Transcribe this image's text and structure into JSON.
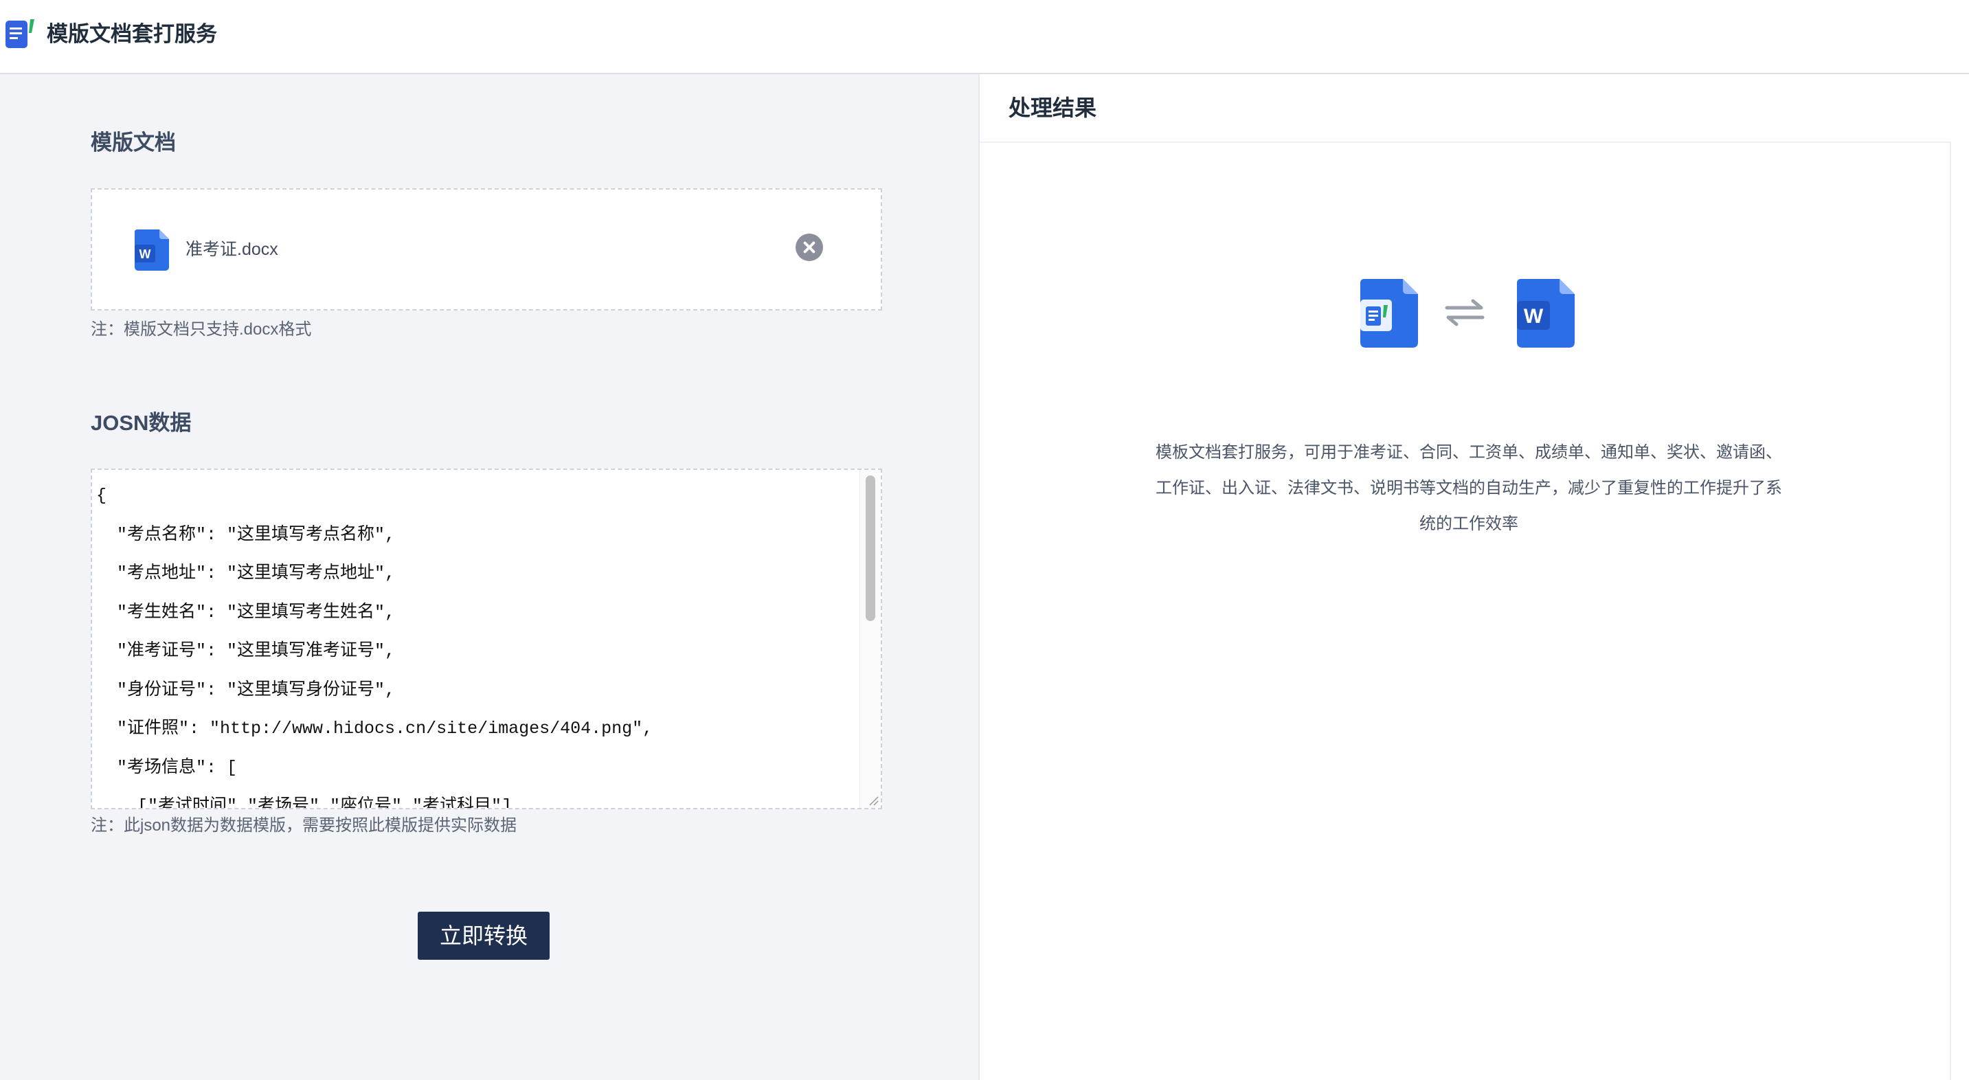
{
  "app": {
    "title": "模版文档套打服务",
    "logo_icon": "document-app-icon"
  },
  "template_section": {
    "title": "模版文档",
    "file_name": "准考证.docx",
    "file_icon": "word-file-icon",
    "remove_icon": "close-circle-icon",
    "note": "注：模版文档只支持.docx格式"
  },
  "json_section": {
    "title": "JOSN数据",
    "content": "{\n  \"考点名称\": \"这里填写考点名称\",\n  \"考点地址\": \"这里填写考点地址\",\n  \"考生姓名\": \"这里填写考生姓名\",\n  \"准考证号\": \"这里填写准考证号\",\n  \"身份证号\": \"这里填写身份证号\",\n  \"证件照\": \"http://www.hidocs.cn/site/images/404.png\",\n  \"考场信息\": [\n    [\"考试时间\",\"考场号\",\"座位号\",\"考试科目\"],",
    "note": "注：此json数据为数据模版，需要按照此模版提供实际数据"
  },
  "actions": {
    "convert_label": "立即转换"
  },
  "result_panel": {
    "title": "处理结果",
    "swap_icon": "swap-arrows-icon",
    "description": "模板文档套打服务，可用于准考证、合同、工资单、成绩单、通知单、奖状、邀请函、工作证、出入证、法律文书、说明书等文档的自动生产，减少了重复性的工作提升了系统的工作效率"
  },
  "colors": {
    "primary_button": "#1f2f50",
    "word_blue": "#2b6ee6",
    "left_bg": "#f2f4f7"
  }
}
